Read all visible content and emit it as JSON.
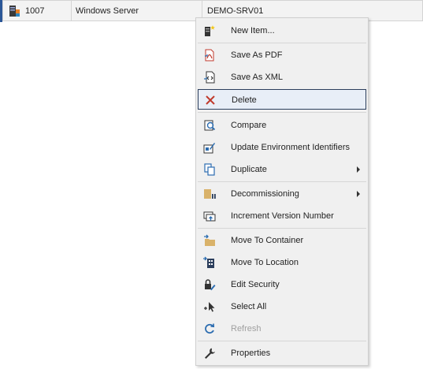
{
  "grid_row": {
    "id": "1007",
    "type": "Windows Server",
    "name": "DEMO-SRV01"
  },
  "menu": {
    "items": [
      {
        "label": "New Item...",
        "icon": "new-item-icon"
      },
      {
        "label": "Save As PDF",
        "icon": "pdf-icon"
      },
      {
        "label": "Save As XML",
        "icon": "xml-icon"
      },
      {
        "label": "Delete",
        "icon": "delete-icon"
      },
      {
        "label": "Compare",
        "icon": "compare-icon"
      },
      {
        "label": "Update Environment Identifiers",
        "icon": "update-identifiers-icon"
      },
      {
        "label": "Duplicate",
        "icon": "duplicate-icon"
      },
      {
        "label": "Decommissioning",
        "icon": "decommission-icon"
      },
      {
        "label": "Increment Version Number",
        "icon": "increment-version-icon"
      },
      {
        "label": "Move To Container",
        "icon": "move-container-icon"
      },
      {
        "label": "Move To Location",
        "icon": "move-location-icon"
      },
      {
        "label": "Edit Security",
        "icon": "security-icon"
      },
      {
        "label": "Select All",
        "icon": "select-all-icon"
      },
      {
        "label": "Refresh",
        "icon": "refresh-icon"
      },
      {
        "label": "Properties",
        "icon": "wrench-icon"
      }
    ]
  },
  "colors": {
    "hover_border": "#2b3e5c",
    "delete_red": "#c0392b",
    "accent_blue": "#2b6cb0",
    "folder_tan": "#d9b26a"
  }
}
